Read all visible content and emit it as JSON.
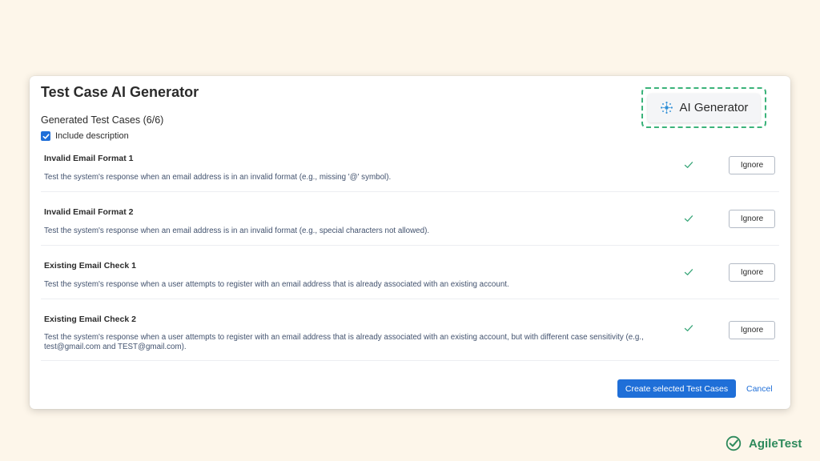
{
  "dialog": {
    "title": "Test Case AI Generator",
    "section_title": "Generated Test Cases (6/6)",
    "include_description_label": "Include description",
    "include_description_checked": true
  },
  "ai_generator": {
    "label": "AI Generator",
    "icon": "sparkle-icon"
  },
  "test_cases": [
    {
      "title": "Invalid Email Format 1",
      "description": "Test the system's response when an email address is in an invalid format (e.g., missing '@' symbol).",
      "selected": true,
      "action_label": "Ignore"
    },
    {
      "title": "Invalid Email Format 2",
      "description": "Test the system's response when an email address is in an invalid format (e.g., special characters not allowed).",
      "selected": true,
      "action_label": "Ignore"
    },
    {
      "title": "Existing Email Check 1",
      "description": "Test the system's response when a user attempts to register with an email address that is already associated with an existing account.",
      "selected": true,
      "action_label": "Ignore"
    },
    {
      "title": "Existing Email Check 2",
      "description": "Test the system's response when a user attempts to register with an email address that is already associated with an existing account, but with different case sensitivity (e.g., test@gmail.com and TEST@gmail.com).",
      "selected": true,
      "action_label": "Ignore"
    }
  ],
  "footer": {
    "create_label": "Create selected Test Cases",
    "cancel_label": "Cancel"
  },
  "brand": {
    "name": "AgileTest",
    "icon": "agiletest-logo-icon"
  },
  "colors": {
    "background": "#fdf6ea",
    "primary": "#1f6fd8",
    "highlight": "#3bb37a",
    "check": "#3aa77a",
    "brand": "#2e8a5c"
  }
}
